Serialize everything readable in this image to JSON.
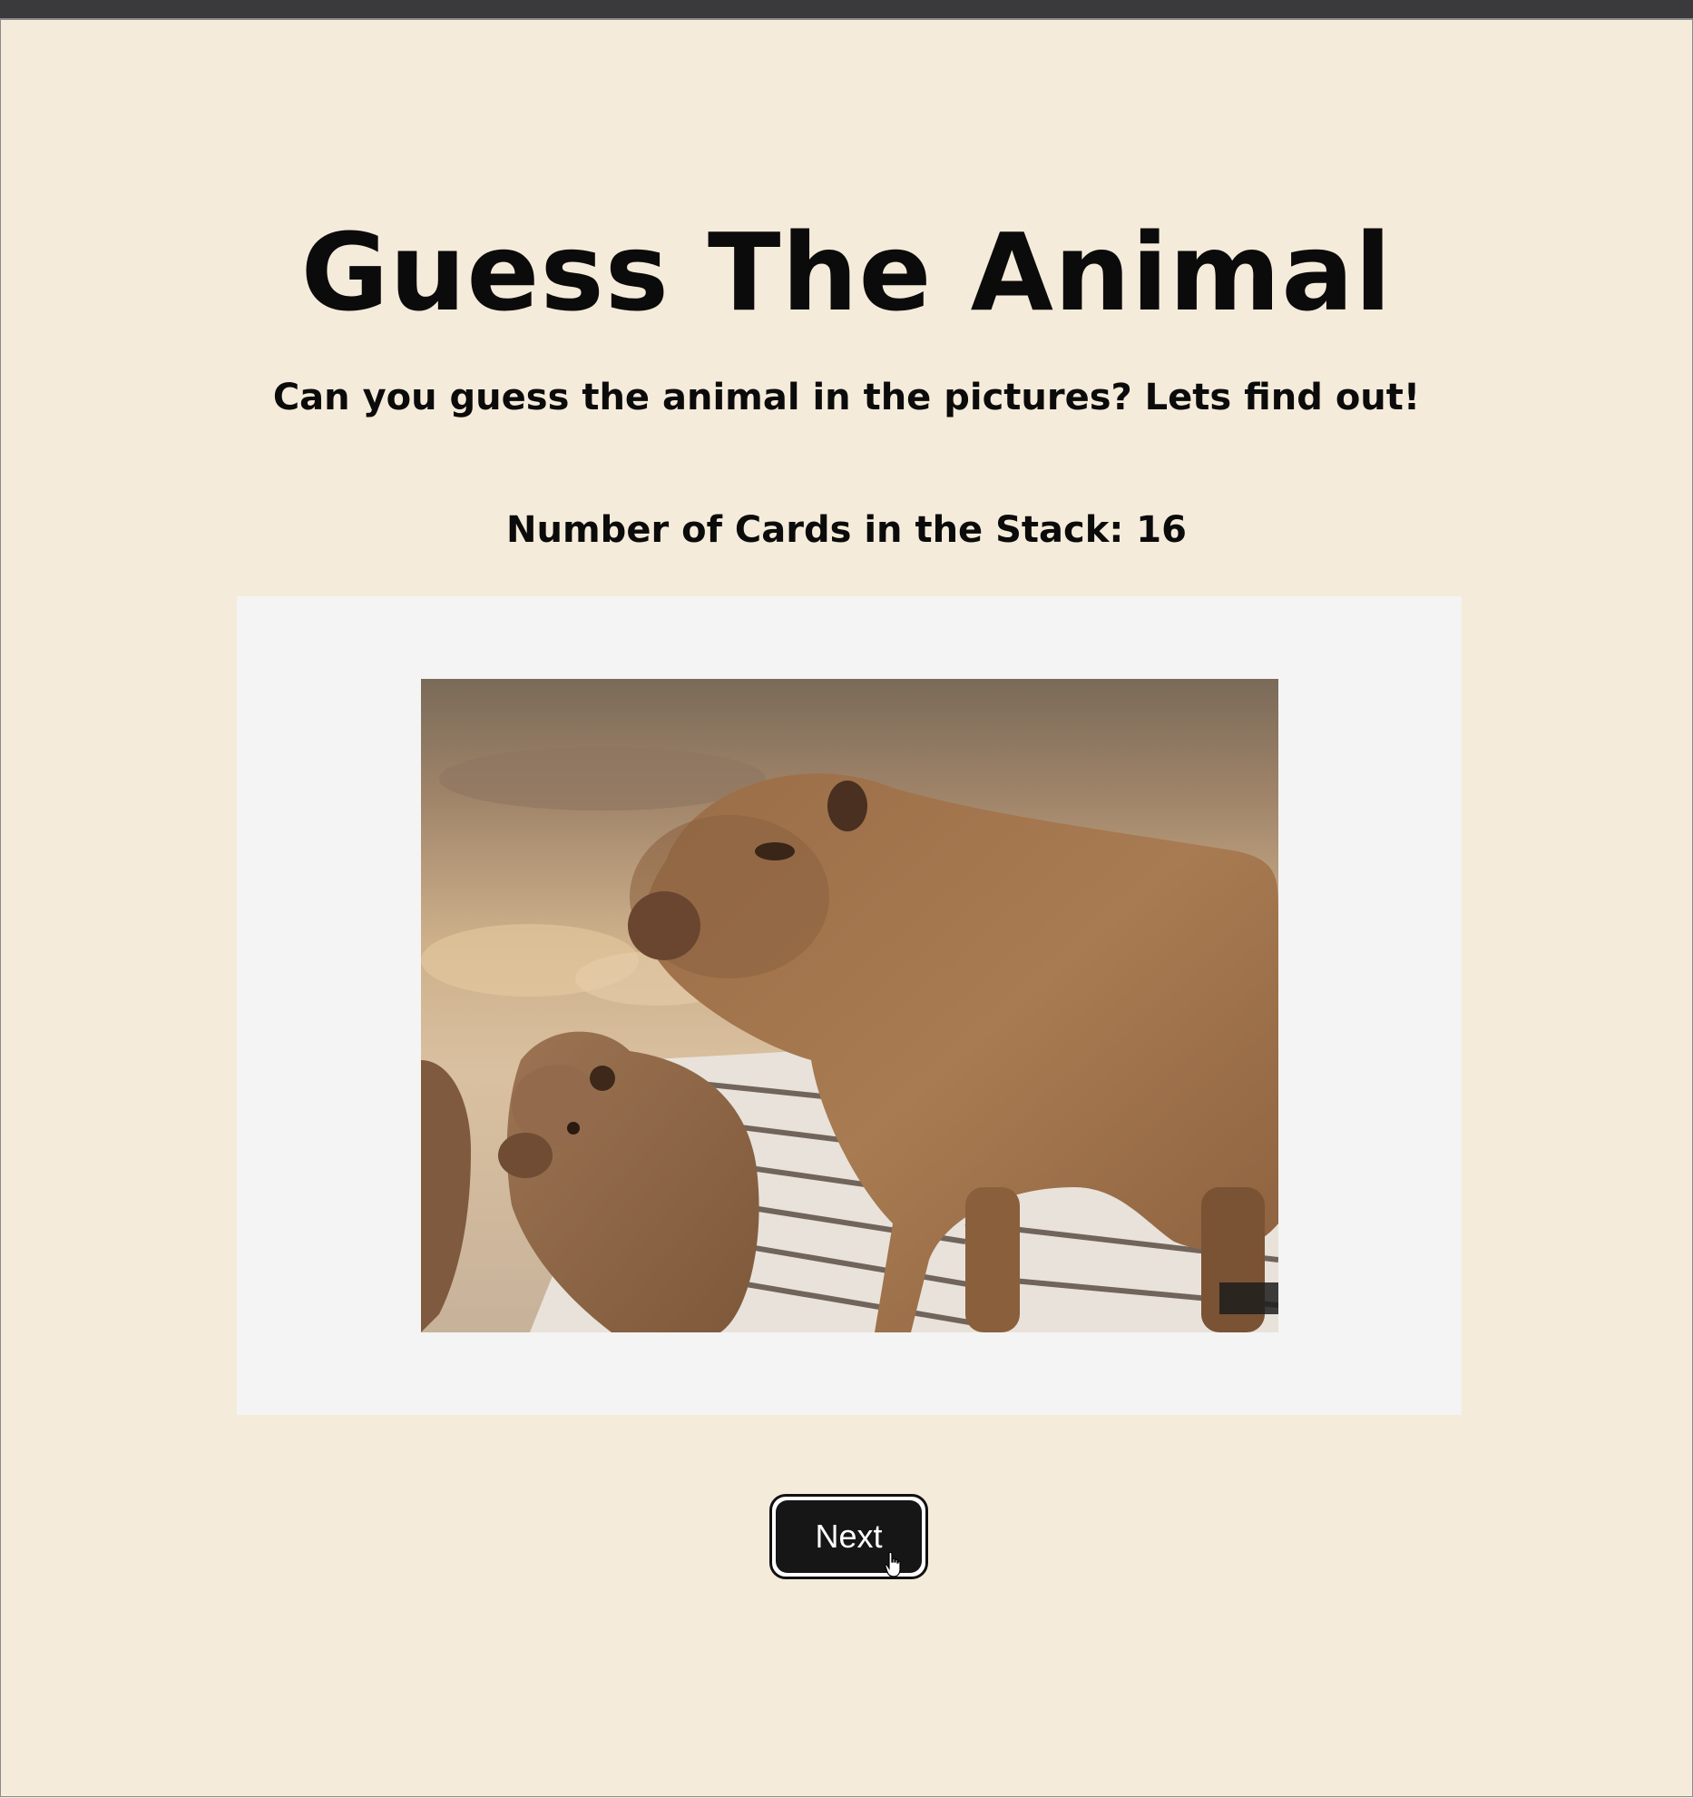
{
  "header": {
    "title": "Guess The Animal",
    "subtitle": "Can you guess the animal in the pictures? Lets find out!",
    "card_count_text": "Number of Cards in the Stack: 16"
  },
  "card": {
    "image_alt": "capybara",
    "image_icon": "capybara-photo"
  },
  "controls": {
    "next_label": "Next"
  },
  "colors": {
    "page_background": "#f5ebda",
    "card_background": "#f4f4f4",
    "button_background": "#161616",
    "button_text": "#ffffff"
  }
}
